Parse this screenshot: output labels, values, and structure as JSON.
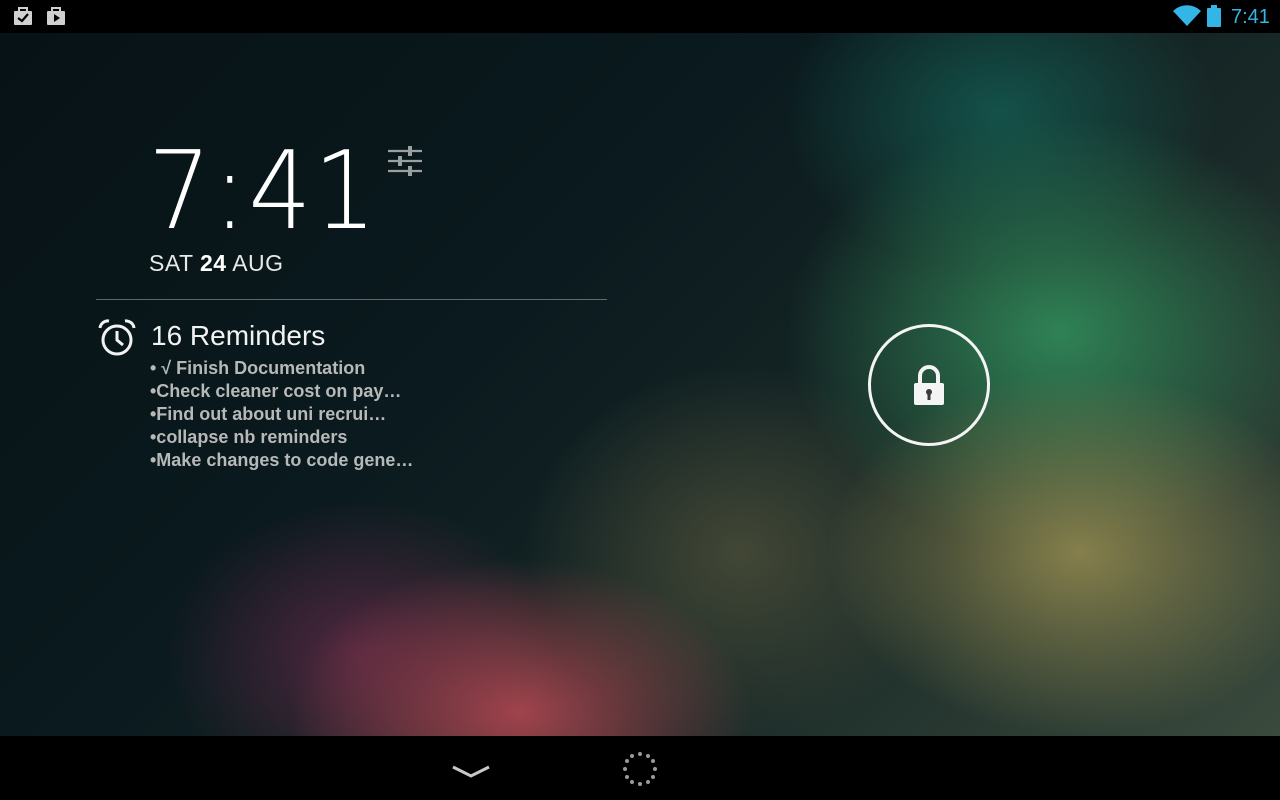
{
  "status_bar": {
    "time": "7:41",
    "accent_color": "#33b5e5",
    "left_icons": [
      "task-check-icon",
      "play-store-icon"
    ],
    "right_icons": [
      "wifi-icon",
      "battery-icon"
    ]
  },
  "lockscreen": {
    "clock": "7:41",
    "date": {
      "day": "SAT",
      "date_num": "24",
      "month": "AUG"
    }
  },
  "reminders_widget": {
    "title": "16 Reminders",
    "items": [
      "• √ Finish Documentation",
      "•Check cleaner cost on pay…",
      "•Find out about uni recrui…",
      "•collapse nb reminders",
      "•Make changes to code gene…"
    ]
  },
  "nav_bar": {
    "icons": [
      "chevron-down-icon",
      "loading-spinner-icon"
    ]
  }
}
